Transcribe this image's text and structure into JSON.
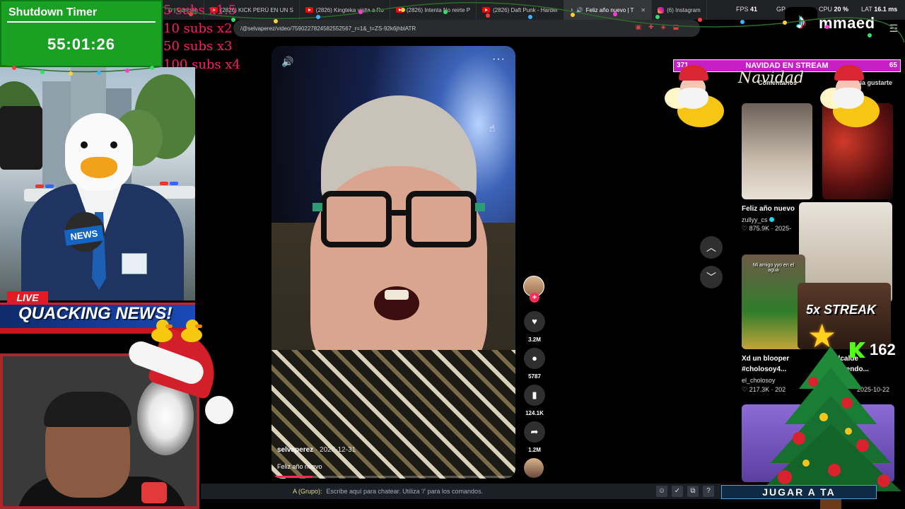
{
  "timer": {
    "title": "Shutdown Timer",
    "value": "55:01:26"
  },
  "sub_goals": [
    "5 subs x1.5",
    "10 subs x2",
    "50 subs x3",
    "100 subs x4"
  ],
  "browser": {
    "tabs": [
      {
        "label": "D | Concien",
        "icon": "youtube-icon"
      },
      {
        "label": "(2826) KICK PERÚ EN UN S",
        "icon": "youtube-icon"
      },
      {
        "label": "(2826) Kingteka visita a Ro",
        "icon": "youtube-icon"
      },
      {
        "label": "(2826) Intenta No reirte P",
        "icon": "youtube-icon"
      },
      {
        "label": "(2826) Daft Punk - Harder",
        "icon": "youtube-icon"
      },
      {
        "label": "Feliz año nuevo | T",
        "icon": "tiktok-icon",
        "active": true
      },
      {
        "label": "(6) Instagram",
        "icon": "instagram-icon"
      }
    ],
    "url": "/@selvaperez/video/7590227824582552567_r=1&_t=ZS-92k6jhblATR",
    "perf": {
      "fps_label": "FPS",
      "fps_value": "41",
      "gpu_label": "GP",
      "cpu_label": "CPU",
      "cpu_value": "20 %",
      "lat_label": "LAT",
      "lat_value": "16.1 ms"
    },
    "channel_name": "mmaed"
  },
  "news_overlay": {
    "mic_label": "NEWS",
    "live_label": "LIVE",
    "headline": "QUACKING NEWS!"
  },
  "video": {
    "author": "selvaperez",
    "date": "2025-12-31",
    "caption": "Feliz año nuevo",
    "progress": 0.16
  },
  "actions": {
    "likes": "3.2M",
    "comments": "5787",
    "saves": "124.1K",
    "shares": "1.2M"
  },
  "right_panel": {
    "banner_left": "371",
    "banner_title": "NAVIDAD EN STREAM",
    "banner_right": "65",
    "tabs": [
      "Comentarios",
      "Podría gustarte"
    ],
    "navidad_script": "Navidad",
    "items": [
      {
        "title": "Feliz año nuevo",
        "user": "zullyy_cs",
        "verified": true,
        "likes": "875.9K",
        "date": "2025-"
      },
      {
        "title": "Xd un blooper #cholosoy4...",
        "user": "el_cholosoy",
        "verified": false,
        "likes": "217.3K",
        "date": "202"
      },
      {
        "title": "alcalde ...viendo...",
        "date": "2025-10-22"
      }
    ],
    "thumb2_text": "Mi amigo yyo en el agua"
  },
  "overlays": {
    "streak": "5x STREAK",
    "kick_count": "162",
    "jugar": "JUGAR A TA"
  },
  "chat": {
    "group_label": "A (Grupo):",
    "placeholder": "Escribe aquí para chatear. Utiliza '/' para los comandos."
  },
  "colors": {
    "timer_bg": "#1aa023",
    "sub_goal_text": "#ff1e6b",
    "tiktok_red": "#fe2c55",
    "banner_magenta": "#c71fc7"
  }
}
